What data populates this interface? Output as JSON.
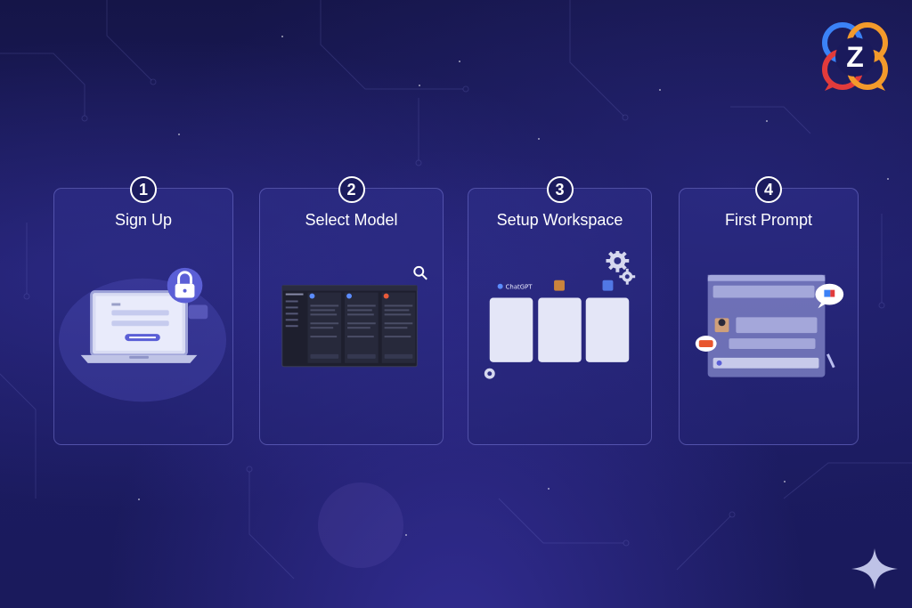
{
  "steps": [
    {
      "number": "1",
      "title": "Sign Up",
      "illustration": "laptop-login-form-with-lock-icon"
    },
    {
      "number": "2",
      "title": "Select Model",
      "illustration": "model-selection-dashboard-with-search-icon"
    },
    {
      "number": "3",
      "title": "Setup Workspace",
      "illustration": "workspace-columns-with-gear-icons",
      "workspace_label": "ChatGPT"
    },
    {
      "number": "4",
      "title": "First Prompt",
      "illustration": "chat-window-with-message-bubbles"
    }
  ],
  "logo": {
    "letter": "Z",
    "icon": "chat-bubbles-logo"
  },
  "colors": {
    "background_top": "#151548",
    "background_bottom": "#1a1a5c",
    "card_border": "#a0a0ff",
    "logo_orange": "#f39a2b",
    "logo_red": "#e23b3b",
    "logo_blue": "#3b82f6",
    "accent_purple": "#5b5fd6"
  }
}
